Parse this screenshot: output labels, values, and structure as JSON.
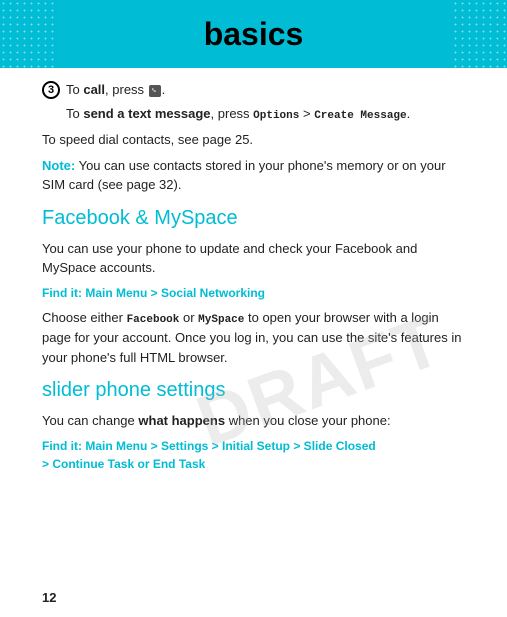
{
  "header": {
    "title": "basics"
  },
  "content": {
    "numbered_item": {
      "number": "3",
      "call_text": "To ",
      "call_bold": "call",
      "call_suffix": ", press ",
      "indent_text": "To ",
      "indent_bold": "send a text message",
      "indent_suffix": ", press ",
      "indent_options": "Options",
      "indent_arrow": " > ",
      "indent_create": "Create Message",
      "indent_period": "."
    },
    "speed_dial": "To speed dial contacts, see page 25.",
    "note_label": "Note:",
    "note_text": " You can use contacts stored in your phone's memory or on your SIM card (see page 32).",
    "facebook_heading": "Facebook & MySpace",
    "facebook_para": "You can use your phone to update and check your Facebook and MySpace accounts.",
    "find_it_label_1": "Find it:",
    "find_it_path_1": " Main Menu > Social Networking",
    "facebook_body": "Choose either ",
    "facebook_bold_1": "Facebook",
    "facebook_or": " or ",
    "facebook_bold_2": "MySpace",
    "facebook_body2": " to open your browser with a login page for your account. Once you log in, you can use the site's features in your phone's full HTML browser.",
    "slider_heading": "slider phone settings",
    "slider_para_1": "You can change ",
    "slider_para_bold": "what happens",
    "slider_para_2": " when you close your phone:",
    "find_it_label_2": "Find it:",
    "find_it_path_2": " Main Menu > Settings > Initial Setup > Slide Closed > Continue Task",
    "find_it_or": " or ",
    "find_it_end": "End Task",
    "page_number": "12",
    "draft_text": "DRAFT"
  }
}
